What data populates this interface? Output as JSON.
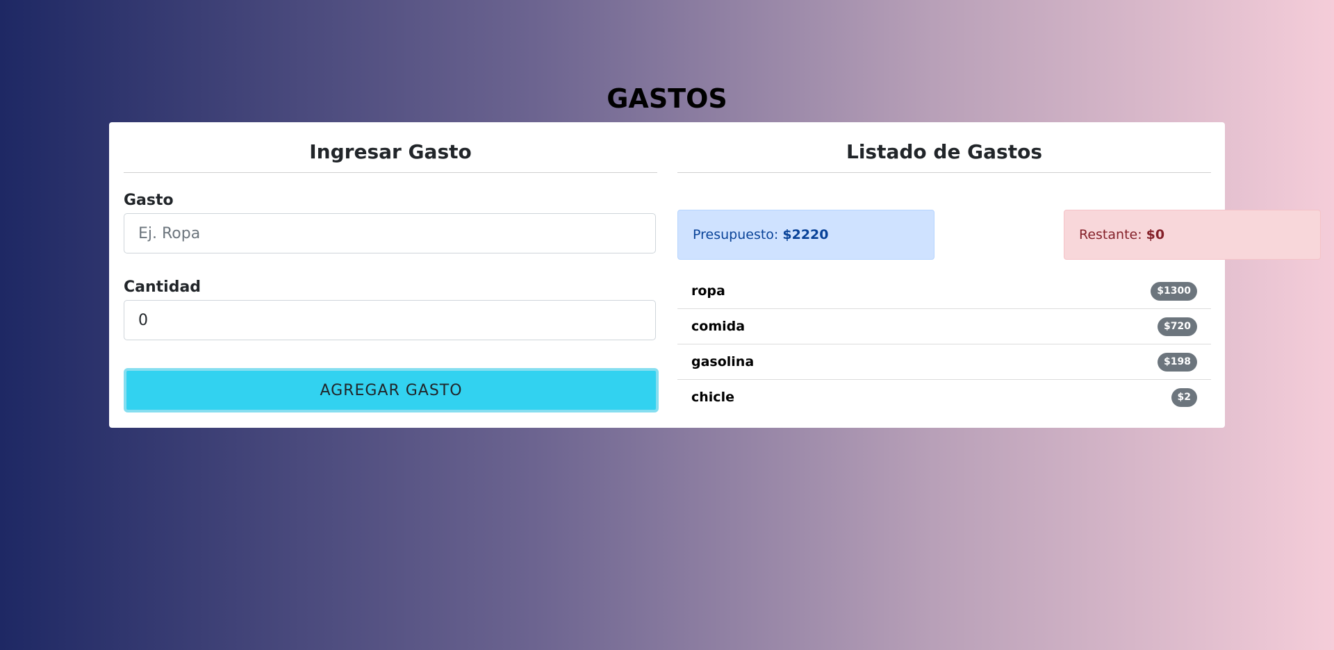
{
  "page": {
    "title": "GASTOS"
  },
  "form": {
    "title": "Ingresar Gasto",
    "expense_label": "Gasto",
    "expense_placeholder": "Ej. Ropa",
    "expense_value": "",
    "amount_label": "Cantidad",
    "amount_value": "0",
    "submit_label": "AGREGAR GASTO"
  },
  "listing": {
    "title": "Listado de Gastos",
    "budget_label": "Presupuesto:",
    "budget_value": "$2220",
    "remaining_label": "Restante:",
    "remaining_value": "$0",
    "items": [
      {
        "name": "ropa",
        "amount": "$1300"
      },
      {
        "name": "comida",
        "amount": "$720"
      },
      {
        "name": "gasolina",
        "amount": "$198"
      },
      {
        "name": "chicle",
        "amount": "$2"
      }
    ]
  },
  "colors": {
    "submit_button": "#32d2f0",
    "budget_alert": "#cfe2ff",
    "remaining_alert": "#f8d7da",
    "badge": "#6c757d"
  }
}
